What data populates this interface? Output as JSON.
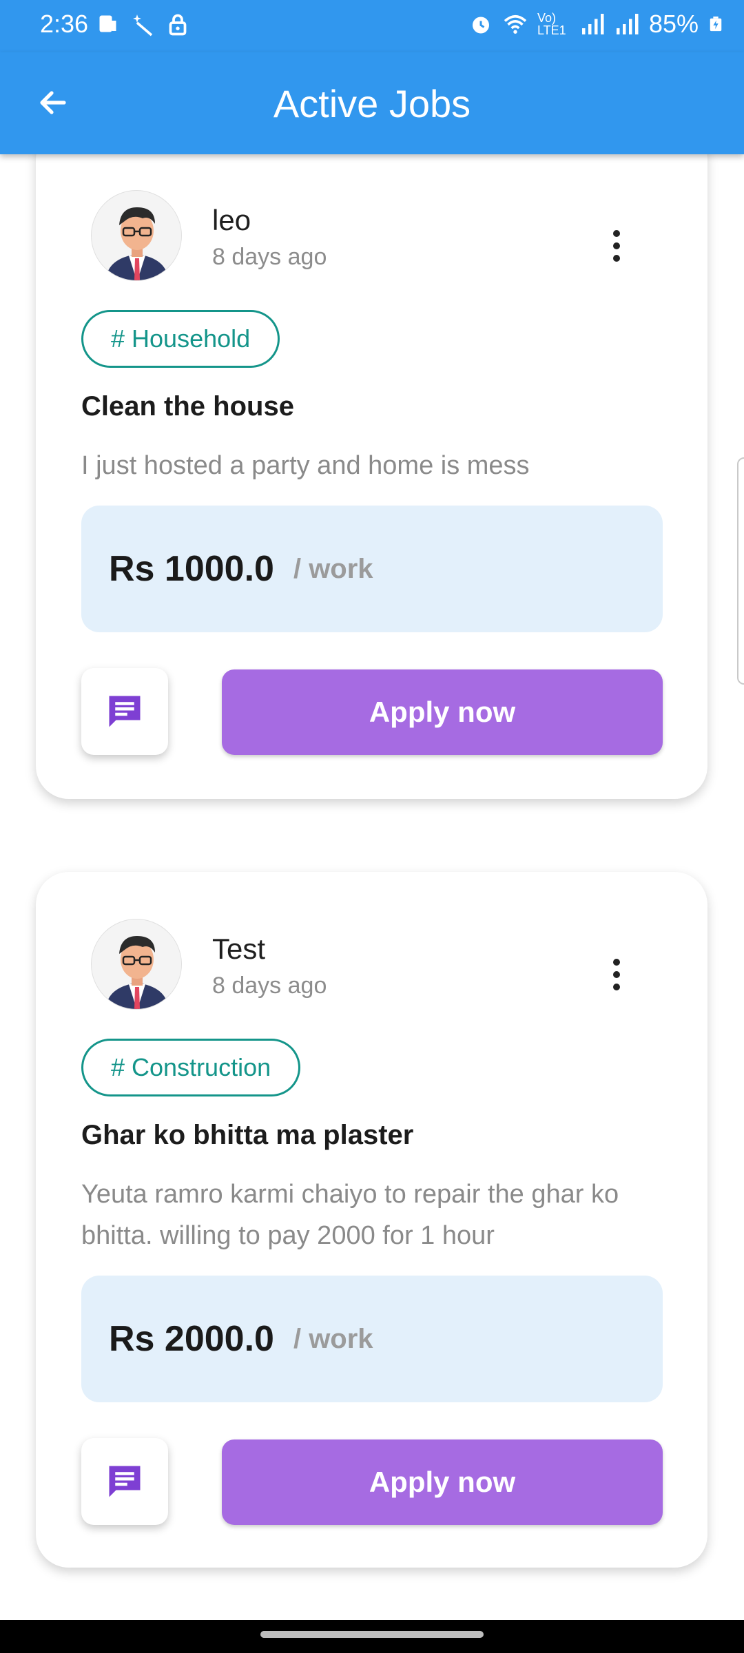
{
  "status_bar": {
    "time": "2:36",
    "battery": "85%",
    "network": "Vo) LTE1"
  },
  "app_bar": {
    "title": "Active Jobs"
  },
  "jobs": [
    {
      "user": "leo",
      "posted": "8 days ago",
      "category": "# Household",
      "title": "Clean the house",
      "description": "I just hosted a party and home is mess",
      "price": "Rs 1000.0",
      "unit": "/ work",
      "apply_label": "Apply now"
    },
    {
      "user": "Test",
      "posted": "8 days ago",
      "category": "# Construction",
      "title": "Ghar ko bhitta ma plaster",
      "description": "Yeuta ramro karmi chaiyo to repair the ghar ko bhitta. willing to pay 2000 for 1 hour",
      "price": "Rs 2000.0",
      "unit": "/ work",
      "apply_label": "Apply now"
    }
  ],
  "colors": {
    "app_bar": "#3197ee",
    "accent_teal": "#14958a",
    "apply_purple": "#a66be2",
    "price_bg": "#e3f0fb"
  }
}
